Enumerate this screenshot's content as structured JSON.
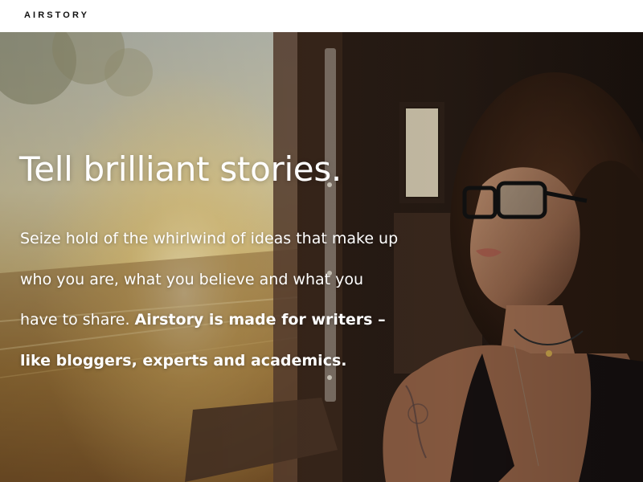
{
  "brand": {
    "name": "AIRSTORY"
  },
  "hero": {
    "image_alt": "Woman with glasses looking out of a train window at sunset",
    "headline": "Tell brilliant stories.",
    "body": {
      "line1": "Seize hold of the whirlwind of ideas that make up",
      "line2": "who you are, what you believe and what you",
      "line3_regular": "have to share. ",
      "line3_bold": "Airstory is made for writers –",
      "line4_bold": "like bloggers, experts and academics."
    }
  },
  "colors": {
    "topbar_bg": "#ffffff",
    "logo_text": "#111111",
    "hero_text": "#ffffff"
  }
}
